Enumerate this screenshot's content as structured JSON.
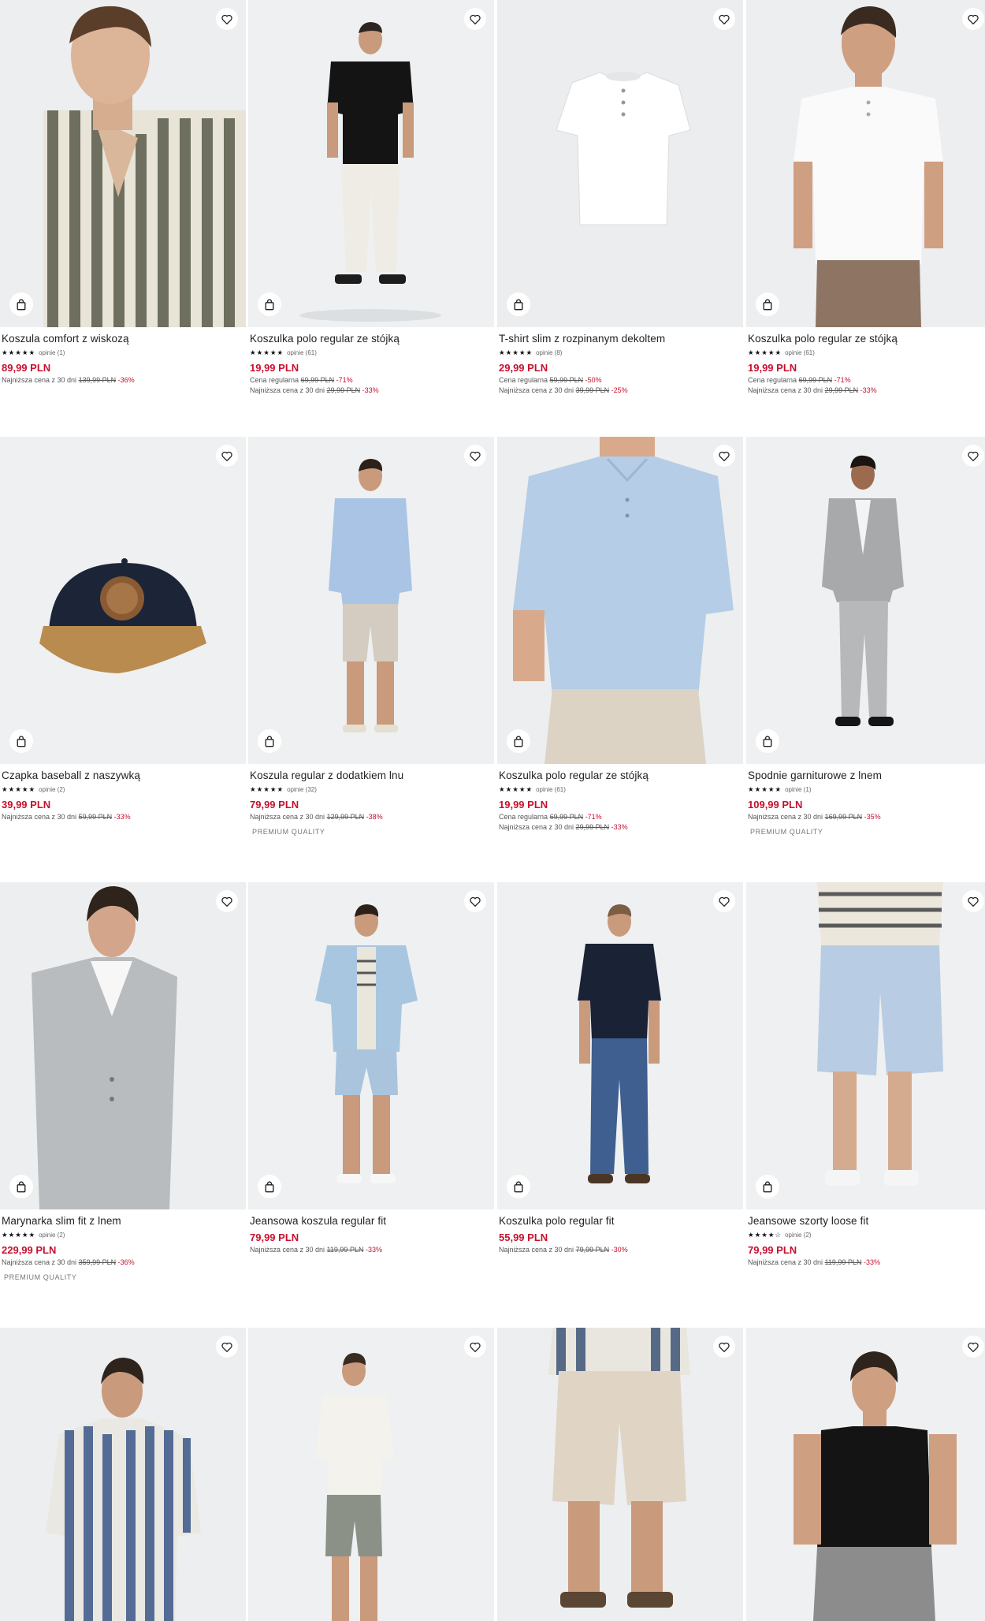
{
  "colors": {
    "price": "#c8102e",
    "tile_bg": "#eef0f1",
    "text": "#222222"
  },
  "icons": {
    "wishlist": "heart-icon",
    "cart": "shopping-bag-icon",
    "rating": "star-icon"
  },
  "products": [
    {
      "name": "Koszula comfort z wiskozą",
      "stars": "★★★★★",
      "reviews": "opinie (1)",
      "price": "89,99 PLN",
      "regular": null,
      "lowest": {
        "label": "Najniższa cena z 30 dni",
        "old": "139,99 PLN",
        "pct": "-36%"
      },
      "badge": null
    },
    {
      "name": "Koszulka polo regular ze stójką",
      "stars": "★★★★★",
      "reviews": "opinie (61)",
      "price": "19,99 PLN",
      "regular": {
        "label": "Cena regularna",
        "old": "69,99 PLN",
        "pct": "-71%"
      },
      "lowest": {
        "label": "Najniższa cena z 30 dni",
        "old": "29,99 PLN",
        "pct": "-33%"
      },
      "badge": null
    },
    {
      "name": "T-shirt slim z rozpinanym dekoltem",
      "stars": "★★★★★",
      "reviews": "opinie (8)",
      "price": "29,99 PLN",
      "regular": {
        "label": "Cena regularna",
        "old": "59,99 PLN",
        "pct": "-50%"
      },
      "lowest": {
        "label": "Najniższa cena z 30 dni",
        "old": "39,99 PLN",
        "pct": "-25%"
      },
      "badge": null
    },
    {
      "name": "Koszulka polo regular ze stójką",
      "stars": "★★★★★",
      "reviews": "opinie (61)",
      "price": "19,99 PLN",
      "regular": {
        "label": "Cena regularna",
        "old": "69,99 PLN",
        "pct": "-71%"
      },
      "lowest": {
        "label": "Najniższa cena z 30 dni",
        "old": "29,99 PLN",
        "pct": "-33%"
      },
      "badge": null
    },
    {
      "name": "Czapka baseball z naszywką",
      "stars": "★★★★★",
      "reviews": "opinie (2)",
      "price": "39,99 PLN",
      "regular": null,
      "lowest": {
        "label": "Najniższa cena z 30 dni",
        "old": "59,99 PLN",
        "pct": "-33%"
      },
      "badge": null
    },
    {
      "name": "Koszula regular z dodatkiem lnu",
      "stars": "★★★★★",
      "reviews": "opinie (32)",
      "price": "79,99 PLN",
      "regular": null,
      "lowest": {
        "label": "Najniższa cena z 30 dni",
        "old": "129,99 PLN",
        "pct": "-38%"
      },
      "badge": "PREMIUM QUALITY"
    },
    {
      "name": "Koszulka polo regular ze stójką",
      "stars": "★★★★★",
      "reviews": "opinie (61)",
      "price": "19,99 PLN",
      "regular": {
        "label": "Cena regularna",
        "old": "69,99 PLN",
        "pct": "-71%"
      },
      "lowest": {
        "label": "Najniższa cena z 30 dni",
        "old": "29,99 PLN",
        "pct": "-33%"
      },
      "badge": null
    },
    {
      "name": "Spodnie garniturowe z lnem",
      "stars": "★★★★★",
      "reviews": "opinie (1)",
      "price": "109,99 PLN",
      "regular": null,
      "lowest": {
        "label": "Najniższa cena z 30 dni",
        "old": "169,99 PLN",
        "pct": "-35%"
      },
      "badge": "PREMIUM QUALITY"
    },
    {
      "name": "Marynarka slim fit z lnem",
      "stars": "★★★★★",
      "reviews": "opinie (2)",
      "price": "229,99 PLN",
      "regular": null,
      "lowest": {
        "label": "Najniższa cena z 30 dni",
        "old": "359,99 PLN",
        "pct": "-36%"
      },
      "badge": "PREMIUM QUALITY"
    },
    {
      "name": "Jeansowa koszula regular fit",
      "stars": null,
      "reviews": null,
      "price": "79,99 PLN",
      "regular": null,
      "lowest": {
        "label": "Najniższa cena z 30 dni",
        "old": "119,99 PLN",
        "pct": "-33%"
      },
      "badge": null
    },
    {
      "name": "Koszulka polo regular fit",
      "stars": null,
      "reviews": null,
      "price": "55,99 PLN",
      "regular": null,
      "lowest": {
        "label": "Najniższa cena z 30 dni",
        "old": "79,99 PLN",
        "pct": "-30%"
      },
      "badge": null
    },
    {
      "name": "Jeansowe szorty loose fit",
      "stars": "★★★★☆",
      "reviews": "opinie (2)",
      "price": "79,99 PLN",
      "regular": null,
      "lowest": {
        "label": "Najniższa cena z 30 dni",
        "old": "119,99 PLN",
        "pct": "-33%"
      },
      "badge": null
    },
    {
      "name": "",
      "stars": null,
      "reviews": null,
      "price": null,
      "regular": null,
      "lowest": null,
      "badge": null
    },
    {
      "name": "",
      "stars": null,
      "reviews": null,
      "price": null,
      "regular": null,
      "lowest": null,
      "badge": null
    },
    {
      "name": "",
      "stars": null,
      "reviews": null,
      "price": null,
      "regular": null,
      "lowest": null,
      "badge": null
    },
    {
      "name": "",
      "stars": null,
      "reviews": null,
      "price": null,
      "regular": null,
      "lowest": null,
      "badge": null
    }
  ]
}
